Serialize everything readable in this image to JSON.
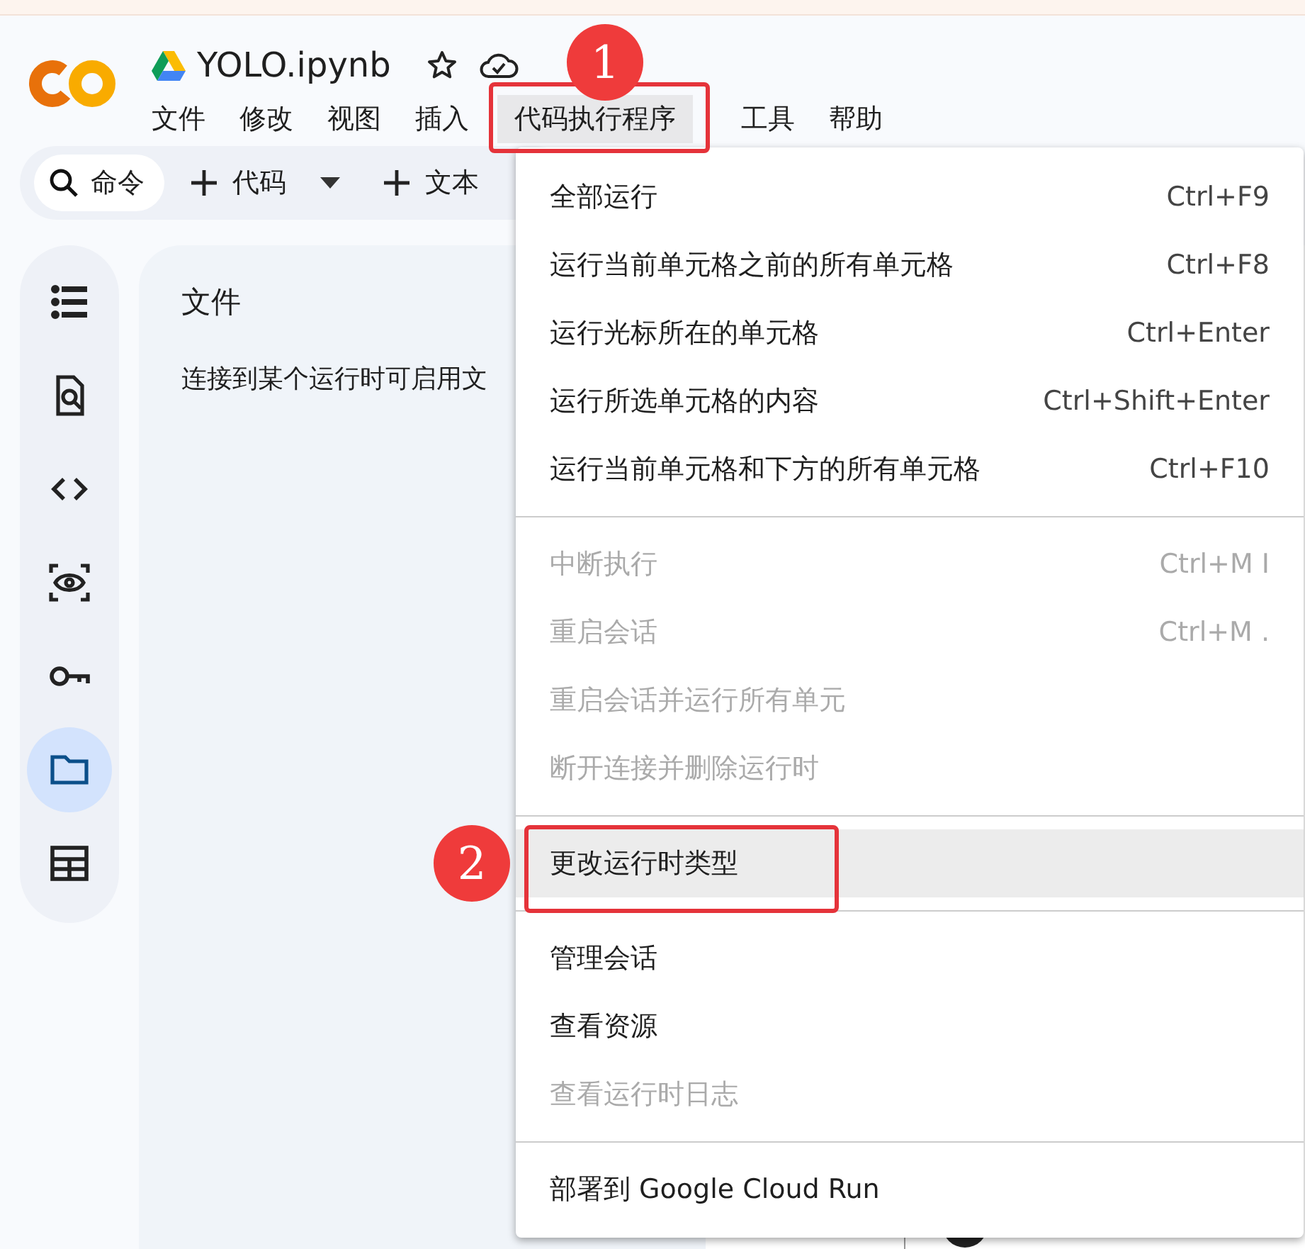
{
  "header": {
    "title": "YOLO.ipynb"
  },
  "menubar": [
    {
      "label": "文件",
      "selected": false
    },
    {
      "label": "修改",
      "selected": false
    },
    {
      "label": "视图",
      "selected": false
    },
    {
      "label": "插入",
      "selected": false
    },
    {
      "label": "代码执行程序",
      "selected": true
    },
    {
      "label": "工具",
      "selected": false
    },
    {
      "label": "帮助",
      "selected": false
    }
  ],
  "toolbar": {
    "command": "命令",
    "add_code": "代码",
    "add_text": "文本"
  },
  "sidebar": {
    "items": [
      {
        "selected": false
      },
      {
        "selected": false
      },
      {
        "selected": false
      },
      {
        "selected": false
      },
      {
        "selected": false
      },
      {
        "selected": true
      },
      {
        "selected": false
      }
    ]
  },
  "files_panel": {
    "title": "文件",
    "message": "连接到某个运行时可启用文"
  },
  "menu": [
    {
      "kind": "item",
      "label": "全部运行",
      "shortcut": "Ctrl+F9",
      "disabled": false,
      "selected": false
    },
    {
      "kind": "item",
      "label": "运行当前单元格之前的所有单元格",
      "shortcut": "Ctrl+F8",
      "disabled": false,
      "selected": false
    },
    {
      "kind": "item",
      "label": "运行光标所在的单元格",
      "shortcut": "Ctrl+Enter",
      "disabled": false,
      "selected": false
    },
    {
      "kind": "item",
      "label": "运行所选单元格的内容",
      "shortcut": "Ctrl+Shift+Enter",
      "disabled": false,
      "selected": false
    },
    {
      "kind": "item",
      "label": "运行当前单元格和下方的所有单元格",
      "shortcut": "Ctrl+F10",
      "disabled": false,
      "selected": false
    },
    {
      "kind": "separator"
    },
    {
      "kind": "item",
      "label": "中断执行",
      "shortcut": "Ctrl+M I",
      "disabled": true,
      "selected": false
    },
    {
      "kind": "item",
      "label": "重启会话",
      "shortcut": "Ctrl+M .",
      "disabled": true,
      "selected": false
    },
    {
      "kind": "item",
      "label": "重启会话并运行所有单元",
      "disabled": true,
      "selected": false
    },
    {
      "kind": "item",
      "label": "断开连接并删除运行时",
      "disabled": true,
      "selected": false
    },
    {
      "kind": "separator"
    },
    {
      "kind": "item",
      "label": "更改运行时类型",
      "disabled": false,
      "selected": true
    },
    {
      "kind": "separator"
    },
    {
      "kind": "item",
      "label": "管理会话",
      "disabled": false,
      "selected": false
    },
    {
      "kind": "item",
      "label": "查看资源",
      "disabled": false,
      "selected": false
    },
    {
      "kind": "item",
      "label": "查看运行时日志",
      "disabled": true,
      "selected": false
    },
    {
      "kind": "separator"
    },
    {
      "kind": "item",
      "label": "部署到 Google Cloud Run",
      "disabled": false,
      "selected": false
    }
  ],
  "annotations": [
    {
      "label": "1"
    },
    {
      "label": "2"
    }
  ]
}
